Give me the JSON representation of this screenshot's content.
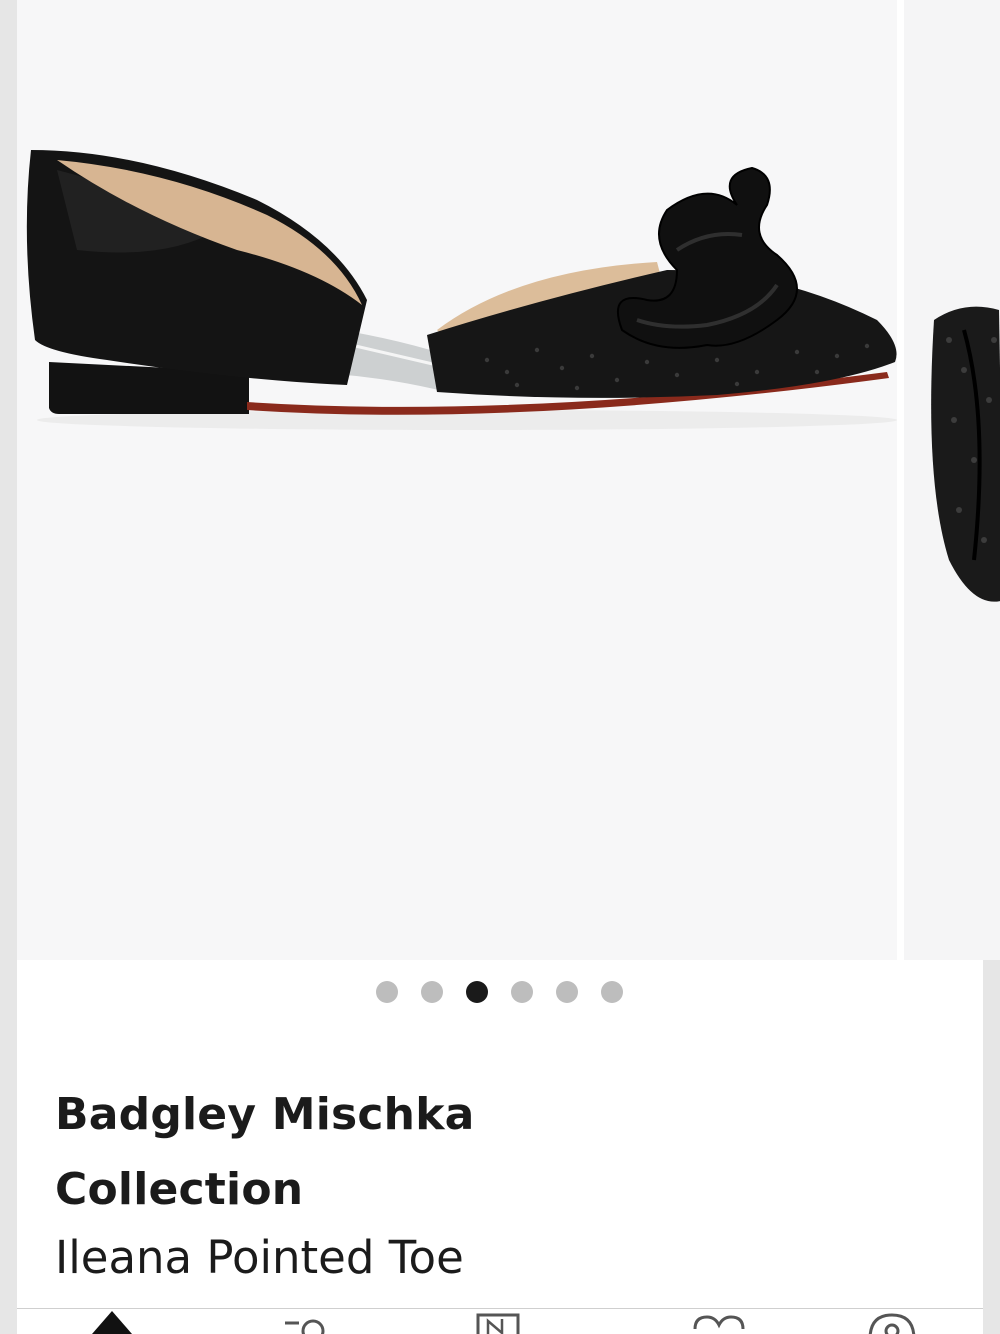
{
  "product": {
    "brand": "Badgley Mischka Collection",
    "name": "Ileana Pointed Toe"
  },
  "gallery": {
    "slide_count": 6,
    "active_index": 2,
    "main_image": "black-pointed-toe-flat-with-crystal-bow",
    "next_image": "crystal-bow-detail"
  },
  "bottom_nav": {
    "items": [
      {
        "icon": "home-icon"
      },
      {
        "icon": "search-icon"
      },
      {
        "icon": "nordstrom-icon"
      },
      {
        "icon": "heart-icon"
      },
      {
        "icon": "location-icon"
      }
    ]
  },
  "colors": {
    "background": "#f7f7f8",
    "text": "#1b1b1b",
    "dot_inactive": "#bdbdbd",
    "dot_active": "#1a1a1a"
  }
}
